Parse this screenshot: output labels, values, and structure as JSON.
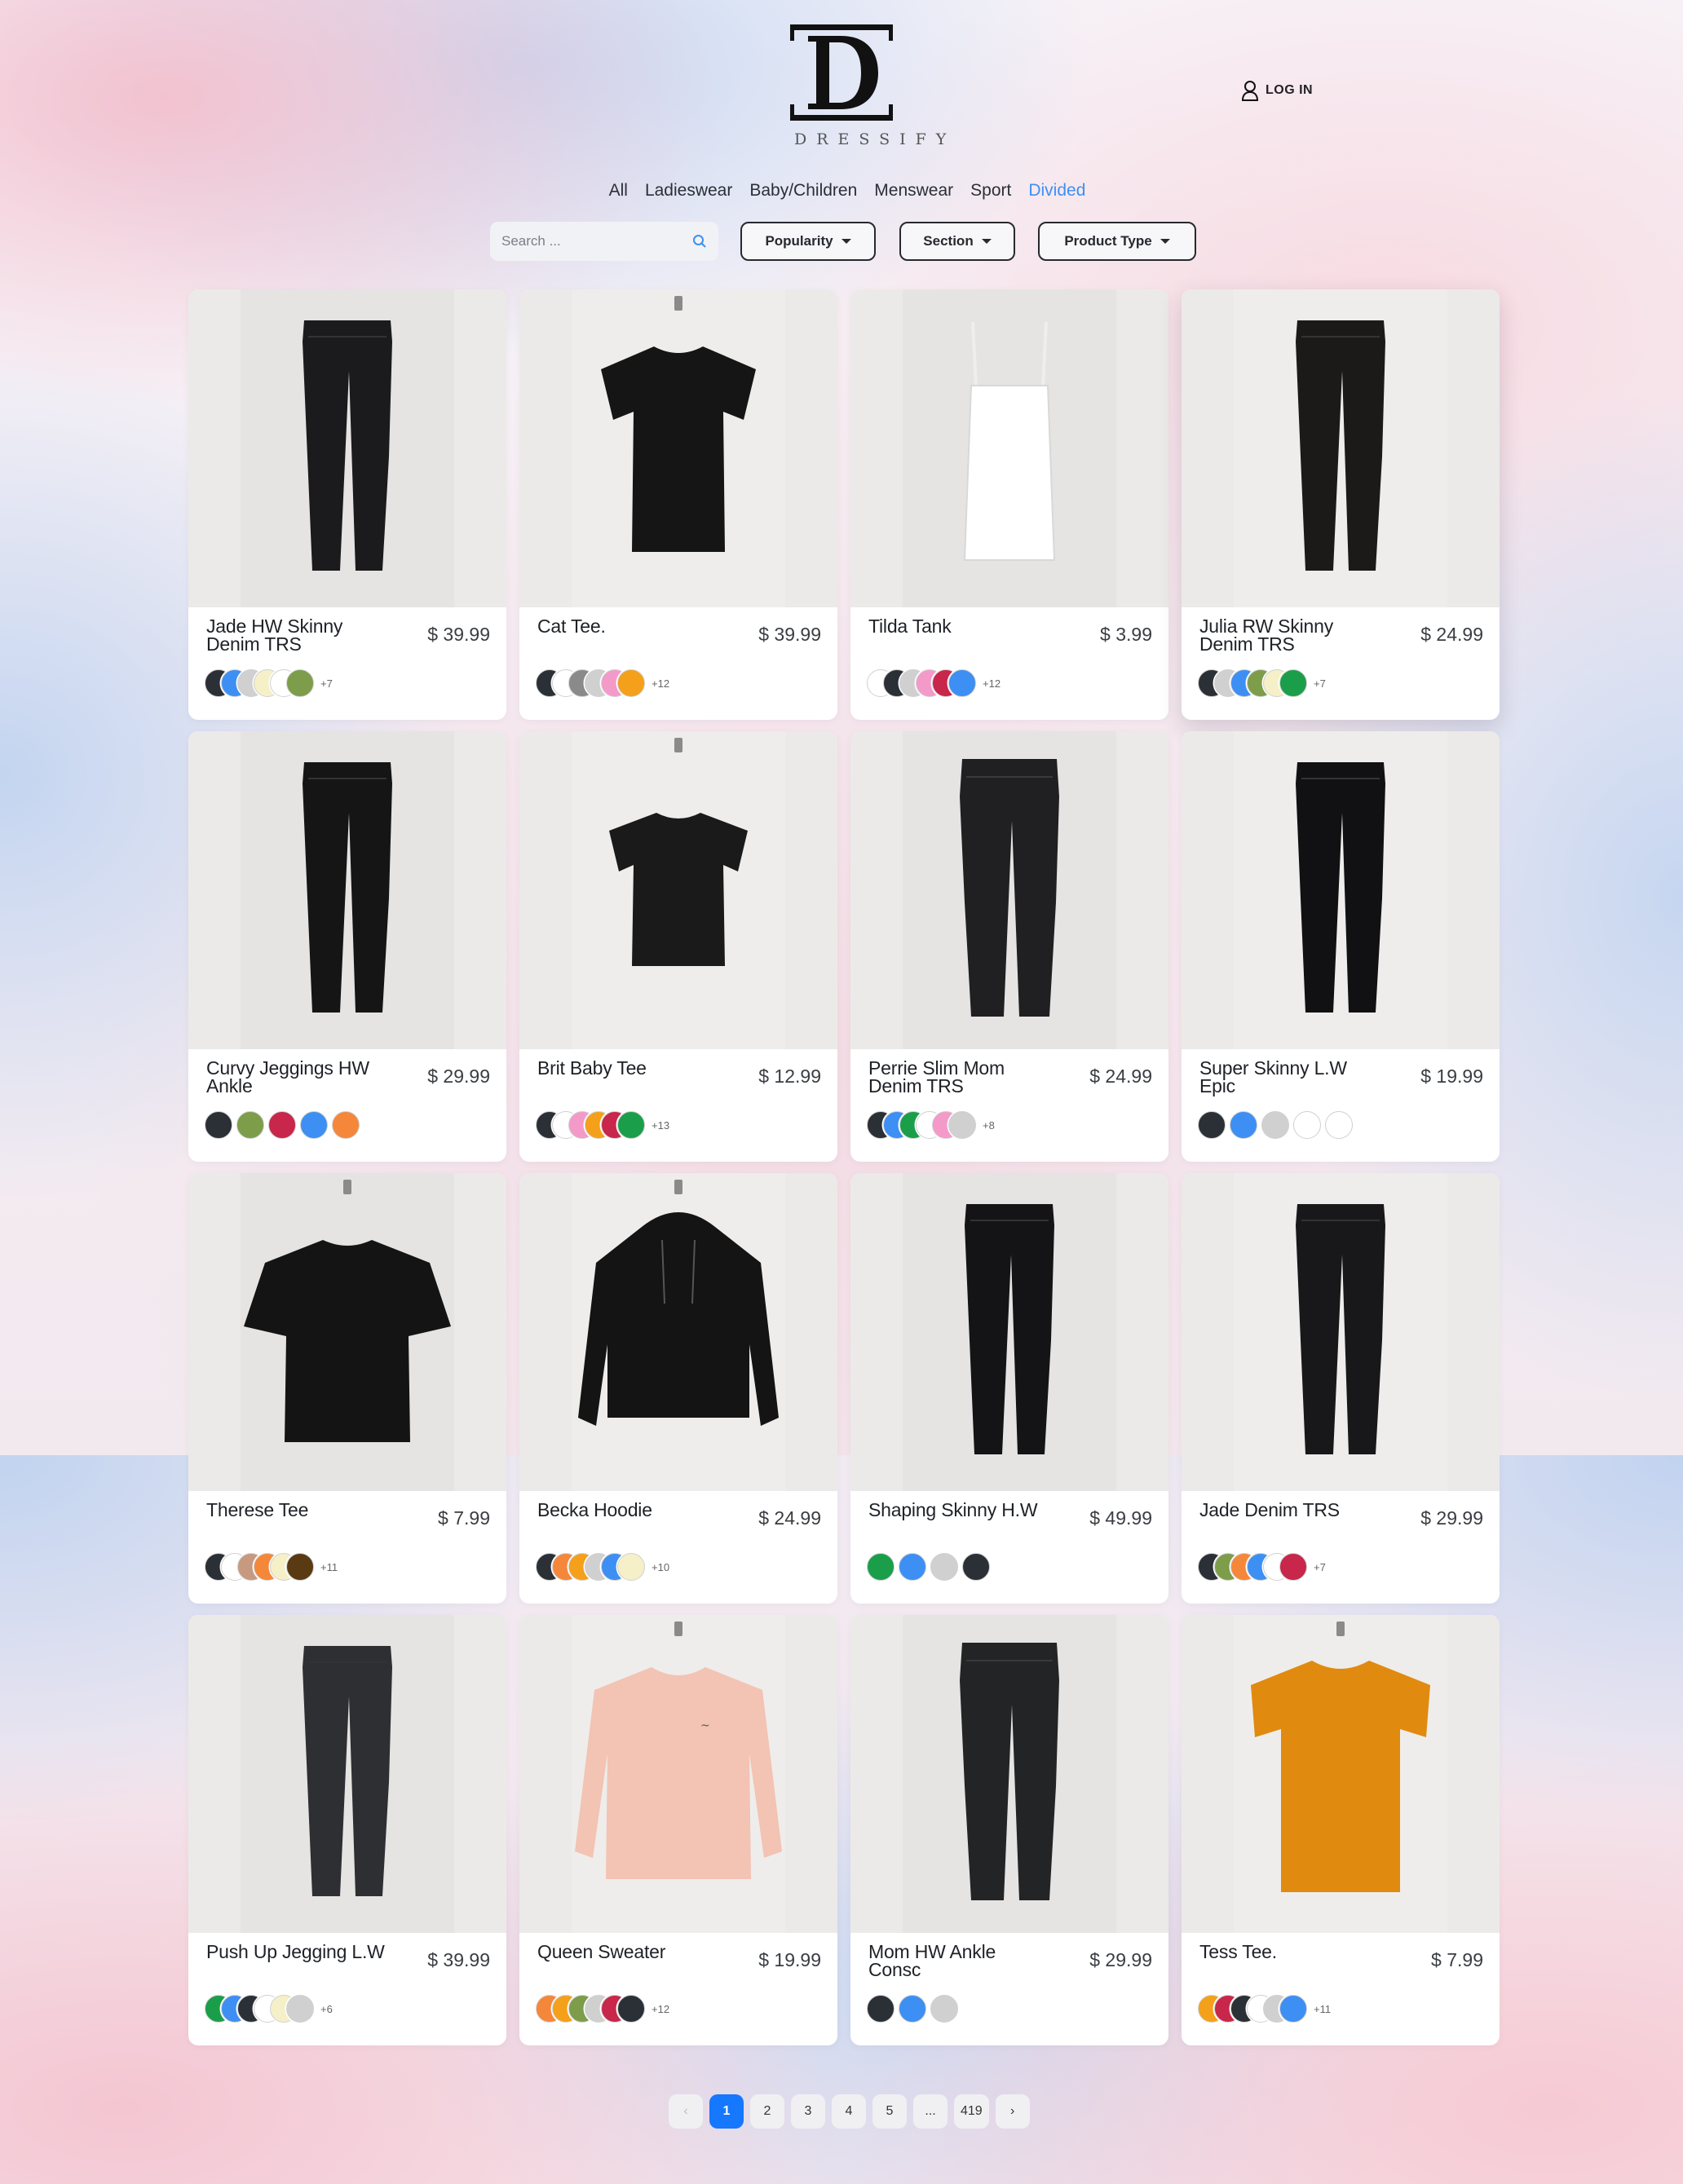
{
  "brand": {
    "name": "DRESSIFY",
    "monogram": "D"
  },
  "header": {
    "login_label": "LOG IN"
  },
  "nav": [
    {
      "label": "All",
      "active": false
    },
    {
      "label": "Ladieswear",
      "active": false
    },
    {
      "label": "Baby/Children",
      "active": false
    },
    {
      "label": "Menswear",
      "active": false
    },
    {
      "label": "Sport",
      "active": false
    },
    {
      "label": "Divided",
      "active": true
    }
  ],
  "filters": {
    "search_placeholder": "Search ...",
    "popularity": "Popularity",
    "section": "Section",
    "product_type": "Product Type"
  },
  "colors": {
    "accent": "#3d8ff3",
    "active_page": "#1677ff"
  },
  "products": [
    {
      "name": "Jade HW Skinny Denim TRS",
      "price": "$ 39.99",
      "kind": "pants",
      "color": "#1b1b1d",
      "swatches": [
        "#2b2f36",
        "#3d8ff3",
        "#d0d0d0",
        "#f5f0c8",
        "#ffffff",
        "#7d9d4a"
      ],
      "more": "+7",
      "mode": "ov"
    },
    {
      "name": "Cat Tee.",
      "price": "$ 39.99",
      "kind": "tee",
      "color": "#151515",
      "swatches": [
        "#2b2f36",
        "#ffffff",
        "#8a8a8a",
        "#d0d0d0",
        "#f49ac9",
        "#f5a01a"
      ],
      "more": "+12",
      "mode": "ov"
    },
    {
      "name": "Tilda Tank",
      "price": "$ 3.99",
      "kind": "tank",
      "color": "#ffffff",
      "swatches": [
        "#ffffff",
        "#2b2f36",
        "#d0d0d0",
        "#f49ac9",
        "#c8264a",
        "#3d8ff3"
      ],
      "more": "+12",
      "mode": "ov"
    },
    {
      "name": "Julia RW Skinny Denim TRS",
      "price": "$ 24.99",
      "kind": "pants",
      "color": "#1c1a19",
      "swatches": [
        "#2b2f36",
        "#d0d0d0",
        "#3d8ff3",
        "#7d9d4a",
        "#f5f0c8",
        "#1b9e4a"
      ],
      "more": "+7",
      "mode": "ov"
    },
    {
      "name": "Curvy Jeggings HW Ankle",
      "price": "$ 29.99",
      "kind": "pants",
      "color": "#151516",
      "swatches": [
        "#2b2f36",
        "#7d9d4a",
        "#c8264a",
        "#3d8ff3",
        "#f5873a"
      ],
      "more": "",
      "mode": "gap"
    },
    {
      "name": "Brit Baby Tee",
      "price": "$ 12.99",
      "kind": "crop",
      "color": "#1a1a1a",
      "swatches": [
        "#2b2f36",
        "#ffffff",
        "#f49ac9",
        "#f5a01a",
        "#c8264a",
        "#1b9e4a"
      ],
      "more": "+13",
      "mode": "ov"
    },
    {
      "name": "Perrie Slim Mom Denim TRS",
      "price": "$ 24.99",
      "kind": "jeans",
      "color": "#202022",
      "swatches": [
        "#2b2f36",
        "#3d8ff3",
        "#1b9e4a",
        "#ffffff",
        "#f49ac9",
        "#d0d0d0"
      ],
      "more": "+8",
      "mode": "ov"
    },
    {
      "name": "Super Skinny L.W Epic",
      "price": "$ 19.99",
      "kind": "pants",
      "color": "#111113",
      "swatches": [
        "#2b2f36",
        "#3d8ff3",
        "#d0d0d0",
        "#ffffff",
        "#ffffff"
      ],
      "more": "",
      "mode": "gap"
    },
    {
      "name": "Therese Tee",
      "price": "$ 7.99",
      "kind": "boxytee",
      "color": "#141414",
      "swatches": [
        "#2b2f36",
        "#ffffff",
        "#c79a80",
        "#f5873a",
        "#f5f0c8",
        "#5a3a12"
      ],
      "more": "+11",
      "mode": "ov"
    },
    {
      "name": "Becka Hoodie",
      "price": "$ 24.99",
      "kind": "hoodie",
      "color": "#141414",
      "swatches": [
        "#2b2f36",
        "#f5873a",
        "#f5a01a",
        "#d0d0d0",
        "#3d8ff3",
        "#f5f0c8"
      ],
      "more": "+10",
      "mode": "ov"
    },
    {
      "name": "Shaping Skinny H.W",
      "price": "$ 49.99",
      "kind": "pants",
      "color": "#141416",
      "swatches": [
        "#1b9e4a",
        "#3d8ff3",
        "#d0d0d0",
        "#2b2f36"
      ],
      "more": "",
      "mode": "gap"
    },
    {
      "name": "Jade Denim TRS",
      "price": "$ 29.99",
      "kind": "pants",
      "color": "#18181a",
      "swatches": [
        "#2b2f36",
        "#7d9d4a",
        "#f5873a",
        "#3d8ff3",
        "#ffffff",
        "#c8264a"
      ],
      "more": "+7",
      "mode": "ov"
    },
    {
      "name": "Push Up Jegging L.W",
      "price": "$ 39.99",
      "kind": "pants",
      "color": "#2e2f33",
      "swatches": [
        "#1b9e4a",
        "#3d8ff3",
        "#2b2f36",
        "#ffffff",
        "#f5f0c8",
        "#d0d0d0"
      ],
      "more": "+6",
      "mode": "ov"
    },
    {
      "name": "Queen Sweater",
      "price": "$ 19.99",
      "kind": "sweater",
      "color": "#f3c3b3",
      "swatches": [
        "#f5873a",
        "#f5a01a",
        "#7d9d4a",
        "#d0d0d0",
        "#c8264a",
        "#2b2f36"
      ],
      "more": "+12",
      "mode": "ov"
    },
    {
      "name": "Mom HW Ankle Consc",
      "price": "$ 29.99",
      "kind": "jeans",
      "color": "#232426",
      "swatches": [
        "#2b2f36",
        "#3d8ff3",
        "#d0d0d0"
      ],
      "more": "",
      "mode": "gap"
    },
    {
      "name": "Tess Tee.",
      "price": "$ 7.99",
      "kind": "longtee",
      "color": "#e18a10",
      "swatches": [
        "#f5a01a",
        "#c8264a",
        "#2b2f36",
        "#ffffff",
        "#d0d0d0",
        "#3d8ff3"
      ],
      "more": "+11",
      "mode": "ov"
    }
  ],
  "pagination": {
    "prev": "‹",
    "pages": [
      "1",
      "2",
      "3",
      "4",
      "5",
      "...",
      "419"
    ],
    "active": "1",
    "next": "›"
  }
}
